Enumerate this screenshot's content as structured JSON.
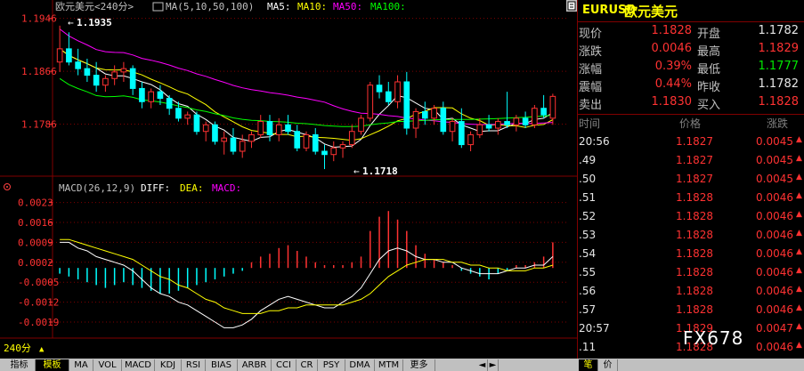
{
  "main_chart": {
    "header": {
      "name": "欧元美元<240分>",
      "ma_label": "MA(5,10,50,100)",
      "ma5": "MA5:",
      "ma10": "MA10:",
      "ma50": "MA50:",
      "ma100": "MA100:"
    },
    "y_ticks": [
      "1.1946",
      "1.1866",
      "1.1786"
    ],
    "high_label": "1.1935",
    "low_label": "1.1718"
  },
  "macd_chart": {
    "header": {
      "name": "MACD(26,12,9)",
      "diff": "DIFF:",
      "dea": "DEA:",
      "macd": "MACD:"
    },
    "y_ticks": [
      "0.0023",
      "0.0016",
      "0.0009",
      "0.0002",
      "-0.0005",
      "-0.0012",
      "-0.0019"
    ]
  },
  "period_selector": "240分",
  "right_panel": {
    "symbol": "EURUSD",
    "name": "欧元美元",
    "quotes": [
      {
        "l1": "现价",
        "v1": "1.1828",
        "c1": "red",
        "l2": "开盘",
        "v2": "1.1782",
        "c2": "white"
      },
      {
        "l1": "涨跌",
        "v1": "0.0046",
        "c1": "red",
        "l2": "最高",
        "v2": "1.1829",
        "c2": "red"
      },
      {
        "l1": "涨幅",
        "v1": "0.39%",
        "c1": "red",
        "l2": "最低",
        "v2": "1.1777",
        "c2": "green"
      },
      {
        "l1": "震幅",
        "v1": "0.44%",
        "c1": "red",
        "l2": "昨收",
        "v2": "1.1782",
        "c2": "white"
      },
      {
        "l1": "卖出",
        "v1": "1.1830",
        "c1": "red",
        "l2": "买入",
        "v2": "1.1828",
        "c2": "red"
      }
    ],
    "ticks_header": {
      "time": "时间",
      "price": "价格",
      "change": "涨跌"
    },
    "ticks": [
      {
        "time": "20:56",
        "price": "1.1827",
        "change": "0.0045"
      },
      {
        "time": ".49",
        "price": "1.1827",
        "change": "0.0045"
      },
      {
        "time": ".50",
        "price": "1.1827",
        "change": "0.0045"
      },
      {
        "time": ".51",
        "price": "1.1828",
        "change": "0.0046"
      },
      {
        "time": ".52",
        "price": "1.1828",
        "change": "0.0046"
      },
      {
        "time": ".53",
        "price": "1.1828",
        "change": "0.0046"
      },
      {
        "time": ".54",
        "price": "1.1828",
        "change": "0.0046"
      },
      {
        "time": ".55",
        "price": "1.1828",
        "change": "0.0046"
      },
      {
        "time": ".56",
        "price": "1.1828",
        "change": "0.0046"
      },
      {
        "time": ".57",
        "price": "1.1828",
        "change": "0.0046"
      },
      {
        "time": "20:57",
        "price": "1.1829",
        "change": "0.0047"
      },
      {
        "time": ".11",
        "price": "1.1828",
        "change": "0.0046"
      }
    ]
  },
  "bottom_tabs": [
    "指标",
    "模板",
    "MA",
    "VOL",
    "MACD",
    "KDJ",
    "RSI",
    "BIAS",
    "ARBR",
    "CCI",
    "CR",
    "PSY",
    "DMA",
    "MTM",
    "更多"
  ],
  "bottom_right_tabs": [
    "笔",
    "价"
  ],
  "watermark": "FX678",
  "colors": {
    "up": "#ff3232",
    "down": "#00ffff",
    "ma5": "#ffffff",
    "ma10": "#ffff00",
    "ma50": "#ff00ff",
    "ma100": "#00ff00"
  },
  "chart_data": {
    "type": "candlestick",
    "price_range": [
      1.171,
      1.1955
    ],
    "candles": [
      {
        "o": 1.188,
        "h": 1.1935,
        "l": 1.1865,
        "c": 1.19
      },
      {
        "o": 1.19,
        "h": 1.1925,
        "l": 1.1875,
        "c": 1.188
      },
      {
        "o": 1.188,
        "h": 1.19,
        "l": 1.186,
        "c": 1.187
      },
      {
        "o": 1.187,
        "h": 1.1885,
        "l": 1.185,
        "c": 1.186
      },
      {
        "o": 1.186,
        "h": 1.188,
        "l": 1.1835,
        "c": 1.1845
      },
      {
        "o": 1.1845,
        "h": 1.186,
        "l": 1.1835,
        "c": 1.1855
      },
      {
        "o": 1.1855,
        "h": 1.1875,
        "l": 1.1845,
        "c": 1.1865
      },
      {
        "o": 1.1865,
        "h": 1.188,
        "l": 1.185,
        "c": 1.187
      },
      {
        "o": 1.187,
        "h": 1.1875,
        "l": 1.183,
        "c": 1.184
      },
      {
        "o": 1.184,
        "h": 1.185,
        "l": 1.181,
        "c": 1.182
      },
      {
        "o": 1.182,
        "h": 1.184,
        "l": 1.181,
        "c": 1.1835
      },
      {
        "o": 1.1835,
        "h": 1.1845,
        "l": 1.1815,
        "c": 1.1825
      },
      {
        "o": 1.1825,
        "h": 1.183,
        "l": 1.18,
        "c": 1.181
      },
      {
        "o": 1.181,
        "h": 1.182,
        "l": 1.179,
        "c": 1.1795
      },
      {
        "o": 1.1795,
        "h": 1.1805,
        "l": 1.1785,
        "c": 1.18
      },
      {
        "o": 1.18,
        "h": 1.1805,
        "l": 1.177,
        "c": 1.1775
      },
      {
        "o": 1.1775,
        "h": 1.179,
        "l": 1.176,
        "c": 1.1785
      },
      {
        "o": 1.1785,
        "h": 1.179,
        "l": 1.1755,
        "c": 1.176
      },
      {
        "o": 1.176,
        "h": 1.1775,
        "l": 1.174,
        "c": 1.1765
      },
      {
        "o": 1.1765,
        "h": 1.178,
        "l": 1.174,
        "c": 1.1745
      },
      {
        "o": 1.1745,
        "h": 1.177,
        "l": 1.1735,
        "c": 1.176
      },
      {
        "o": 1.176,
        "h": 1.1775,
        "l": 1.175,
        "c": 1.177
      },
      {
        "o": 1.177,
        "h": 1.18,
        "l": 1.1765,
        "c": 1.179
      },
      {
        "o": 1.179,
        "h": 1.18,
        "l": 1.176,
        "c": 1.177
      },
      {
        "o": 1.177,
        "h": 1.1795,
        "l": 1.176,
        "c": 1.1785
      },
      {
        "o": 1.1785,
        "h": 1.18,
        "l": 1.177,
        "c": 1.1775
      },
      {
        "o": 1.1775,
        "h": 1.1785,
        "l": 1.1745,
        "c": 1.175
      },
      {
        "o": 1.175,
        "h": 1.1775,
        "l": 1.1745,
        "c": 1.177
      },
      {
        "o": 1.177,
        "h": 1.178,
        "l": 1.174,
        "c": 1.1745
      },
      {
        "o": 1.1745,
        "h": 1.1755,
        "l": 1.1718,
        "c": 1.174
      },
      {
        "o": 1.174,
        "h": 1.176,
        "l": 1.173,
        "c": 1.175
      },
      {
        "o": 1.175,
        "h": 1.176,
        "l": 1.1735,
        "c": 1.1755
      },
      {
        "o": 1.1755,
        "h": 1.1785,
        "l": 1.175,
        "c": 1.1775
      },
      {
        "o": 1.1775,
        "h": 1.18,
        "l": 1.177,
        "c": 1.1795
      },
      {
        "o": 1.1795,
        "h": 1.185,
        "l": 1.179,
        "c": 1.1845
      },
      {
        "o": 1.1845,
        "h": 1.186,
        "l": 1.1825,
        "c": 1.1835
      },
      {
        "o": 1.1835,
        "h": 1.185,
        "l": 1.1815,
        "c": 1.182
      },
      {
        "o": 1.182,
        "h": 1.186,
        "l": 1.181,
        "c": 1.185
      },
      {
        "o": 1.185,
        "h": 1.1865,
        "l": 1.177,
        "c": 1.178
      },
      {
        "o": 1.178,
        "h": 1.181,
        "l": 1.1765,
        "c": 1.1805
      },
      {
        "o": 1.1805,
        "h": 1.182,
        "l": 1.1785,
        "c": 1.1795
      },
      {
        "o": 1.1795,
        "h": 1.1815,
        "l": 1.1785,
        "c": 1.181
      },
      {
        "o": 1.181,
        "h": 1.182,
        "l": 1.177,
        "c": 1.1775
      },
      {
        "o": 1.1775,
        "h": 1.1795,
        "l": 1.176,
        "c": 1.179
      },
      {
        "o": 1.179,
        "h": 1.181,
        "l": 1.175,
        "c": 1.1755
      },
      {
        "o": 1.1755,
        "h": 1.1775,
        "l": 1.1745,
        "c": 1.177
      },
      {
        "o": 1.177,
        "h": 1.1795,
        "l": 1.1765,
        "c": 1.1785
      },
      {
        "o": 1.1785,
        "h": 1.18,
        "l": 1.1775,
        "c": 1.178
      },
      {
        "o": 1.178,
        "h": 1.1795,
        "l": 1.177,
        "c": 1.179
      },
      {
        "o": 1.179,
        "h": 1.1835,
        "l": 1.178,
        "c": 1.1785
      },
      {
        "o": 1.1785,
        "h": 1.18,
        "l": 1.1775,
        "c": 1.1795
      },
      {
        "o": 1.1795,
        "h": 1.1805,
        "l": 1.178,
        "c": 1.1785
      },
      {
        "o": 1.1785,
        "h": 1.1815,
        "l": 1.178,
        "c": 1.181
      },
      {
        "o": 1.181,
        "h": 1.183,
        "l": 1.1795,
        "c": 1.18
      },
      {
        "o": 1.1795,
        "h": 1.1832,
        "l": 1.1785,
        "c": 1.1828
      }
    ],
    "macd_hist": [
      -0.0002,
      -0.0003,
      -0.0004,
      -0.0005,
      -0.0006,
      -0.0007,
      -0.0006,
      -0.0005,
      -0.0006,
      -0.0007,
      -0.0008,
      -0.0009,
      -0.0009,
      -0.0008,
      -0.0007,
      -0.0006,
      -0.0005,
      -0.0004,
      -0.0003,
      -0.0002,
      -0.0001,
      0.0002,
      0.0004,
      0.0005,
      0.0007,
      0.0008,
      0.0006,
      0.0004,
      0.0002,
      0.0001,
      0.0001,
      0.0001,
      0.0002,
      0.0004,
      0.0013,
      0.0018,
      0.002,
      0.0017,
      0.0013,
      0.0008,
      0.0005,
      0.0003,
      0.0002,
      0.0001,
      -0.0001,
      -0.0002,
      -0.0003,
      -0.0004,
      -0.0002,
      -0.0001,
      0.0001,
      0.0001,
      0.0002,
      0.0004,
      0.0009
    ],
    "diff": [
      0.0009,
      0.0009,
      0.0007,
      0.0006,
      0.0004,
      0.0003,
      0.0002,
      0.0001,
      -0.0001,
      -0.0004,
      -0.0007,
      -0.0009,
      -0.001,
      -0.0012,
      -0.0013,
      -0.0015,
      -0.0017,
      -0.0019,
      -0.0021,
      -0.0021,
      -0.002,
      -0.0018,
      -0.0015,
      -0.0013,
      -0.0011,
      -0.001,
      -0.0011,
      -0.0012,
      -0.0013,
      -0.0014,
      -0.0014,
      -0.0012,
      -0.001,
      -0.0007,
      -0.0002,
      0.0003,
      0.0006,
      0.0007,
      0.0006,
      0.0004,
      0.0003,
      0.0003,
      0.0002,
      0.0002,
      0.0,
      -0.0001,
      -0.0002,
      -0.0002,
      -0.0002,
      -0.0001,
      0.0,
      0.0,
      0.0001,
      0.0001,
      0.0004
    ],
    "dea": [
      0.001,
      0.001,
      0.0009,
      0.0008,
      0.0007,
      0.0006,
      0.0005,
      0.0004,
      0.0003,
      0.0001,
      -0.0001,
      -0.0003,
      -0.0004,
      -0.0006,
      -0.0007,
      -0.0009,
      -0.0011,
      -0.0012,
      -0.0014,
      -0.0015,
      -0.0016,
      -0.0016,
      -0.0016,
      -0.0015,
      -0.0015,
      -0.0014,
      -0.0014,
      -0.0013,
      -0.0013,
      -0.0013,
      -0.0013,
      -0.0013,
      -0.0012,
      -0.0011,
      -0.0009,
      -0.0006,
      -0.0003,
      -0.0001,
      0.0001,
      0.0002,
      0.0003,
      0.0003,
      0.0003,
      0.0002,
      0.0002,
      0.0001,
      0.0001,
      0.0,
      0.0,
      -0.0001,
      -0.0001,
      -0.0001,
      0.0,
      0.0,
      0.0001
    ]
  }
}
